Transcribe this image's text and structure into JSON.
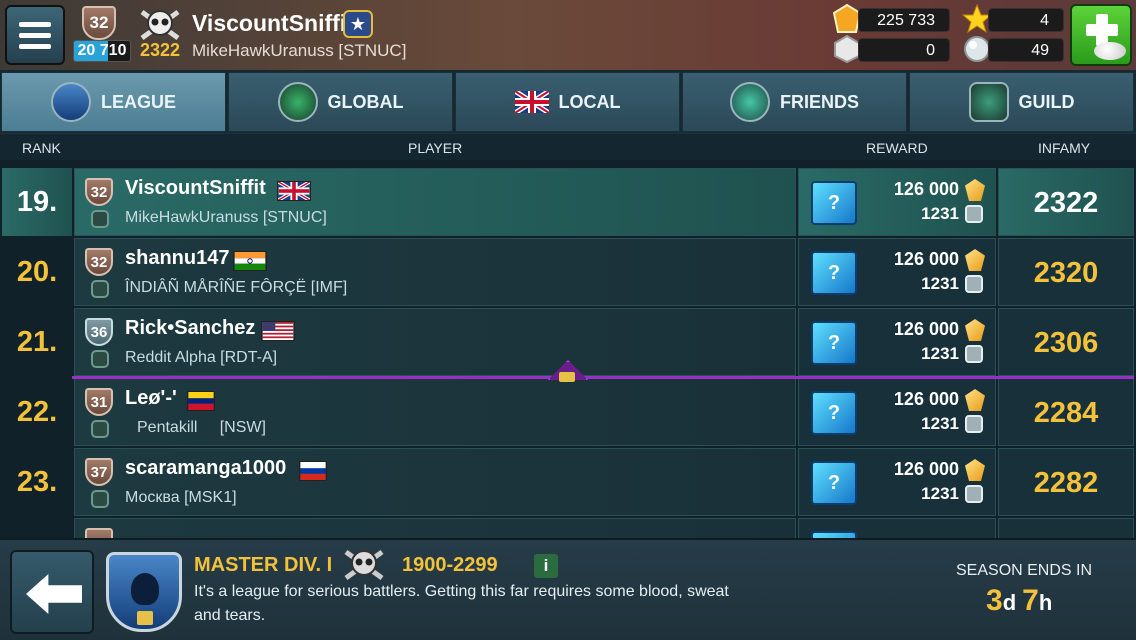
{
  "header": {
    "level": "32",
    "xp": "20 710",
    "xp_fraction": 0.6,
    "infamy": "2322",
    "player_name": "ViscountSniffit",
    "guild": "MikeHawkUranuss [STNUC]",
    "gold": "225 733",
    "silver": "0",
    "stars": "4",
    "pearls": "49"
  },
  "tabs": [
    {
      "label": "LEAGUE",
      "active": true
    },
    {
      "label": "GLOBAL",
      "active": false
    },
    {
      "label": "LOCAL",
      "active": false
    },
    {
      "label": "FRIENDS",
      "active": false
    },
    {
      "label": "GUILD",
      "active": false
    }
  ],
  "table_headers": {
    "rank": "RANK",
    "player": "PLAYER",
    "reward": "REWARD",
    "infamy": "INFAMY"
  },
  "rows": [
    {
      "rank": "19.",
      "level": "32",
      "name": "ViscountSniffit",
      "flag": "uk",
      "guild": "MikeHawkUranuss [STNUC]",
      "reward_gold": "126 000",
      "reward_silver": "1231",
      "chest_label": "?",
      "infamy": "2322",
      "me": true
    },
    {
      "rank": "20.",
      "level": "32",
      "name": "shannu147",
      "flag": "india",
      "guild": "ÎNDIÂÑ MÅRÎÑE FÔRÇË [IMF]",
      "reward_gold": "126 000",
      "reward_silver": "1231",
      "chest_label": "?",
      "infamy": "2320",
      "me": false
    },
    {
      "rank": "21.",
      "level": "36",
      "name": "Rick•Sanchez",
      "flag": "usa",
      "guild": "Reddit Alpha [RDT-A]",
      "reward_gold": "126 000",
      "reward_silver": "1231",
      "chest_label": "?",
      "infamy": "2306",
      "me": false
    },
    {
      "rank": "22.",
      "level": "31",
      "name": "Leø'-'",
      "flag": "venezuela",
      "guild": "Pentakill     [NSW]",
      "reward_gold": "126 000",
      "reward_silver": "1231",
      "chest_label": "?",
      "infamy": "2284",
      "me": false
    },
    {
      "rank": "23.",
      "level": "37",
      "name": "scaramanga1000",
      "flag": "russia",
      "guild": "Москва [MSK1]",
      "reward_gold": "126 000",
      "reward_silver": "1231",
      "chest_label": "?",
      "infamy": "2282",
      "me": false
    }
  ],
  "bottom": {
    "division": "MASTER DIV. I",
    "range": "1900-2299",
    "info": "i",
    "description": "It's a league for serious battlers. Getting this far requires some blood, sweat and tears.",
    "season_label": "SEASON ENDS IN",
    "days": "3",
    "days_unit": "d",
    "hours": "7",
    "hours_unit": "h"
  },
  "colors": {
    "accent_gold": "#f4c23a",
    "highlight_row": "#2a6a66",
    "divider_purple": "#9a2ec9"
  }
}
